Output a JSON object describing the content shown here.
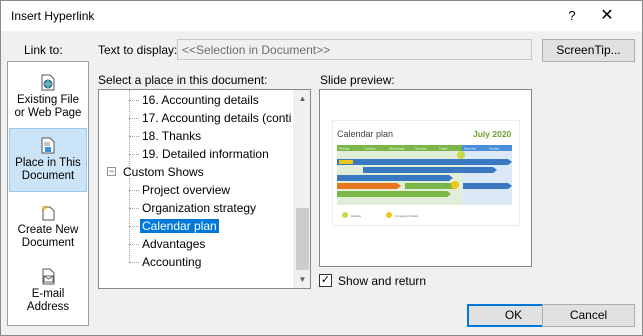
{
  "window": {
    "title": "Insert Hyperlink",
    "help_glyph": "?",
    "close_glyph": "✕"
  },
  "link_to": {
    "label": "Link to:",
    "items": [
      {
        "label_line1": "Existing File",
        "label_line2": "or Web Page",
        "icon": "globe-document-icon"
      },
      {
        "label_line1": "Place in This",
        "label_line2": "Document",
        "icon": "document-place-icon",
        "selected": true
      },
      {
        "label_line1": "Create New",
        "label_line2": "Document",
        "icon": "new-document-icon"
      },
      {
        "label_line1": "E-mail",
        "label_line2": "Address",
        "icon": "email-icon"
      }
    ]
  },
  "text_to_display": {
    "label": "Text to display:",
    "value": "<<Selection in Document>>"
  },
  "screentip_label": "ScreenTip...",
  "place": {
    "label": "Select a place in this document:",
    "items": [
      {
        "text": "16. Accounting details"
      },
      {
        "text": "17. Accounting details (conti"
      },
      {
        "text": "18. Thanks"
      },
      {
        "text": "19. Detailed information"
      },
      {
        "text": "Custom Shows",
        "expander": "−"
      },
      {
        "text": "Project overview"
      },
      {
        "text": "Organization strategy"
      },
      {
        "text": "Calendar plan",
        "selected": true
      },
      {
        "text": "Advantages"
      },
      {
        "text": "Accounting"
      }
    ]
  },
  "slide_preview": {
    "label": "Slide preview:",
    "slide_title": "Calendar plan",
    "slide_date": "July 2020",
    "days": [
      "Monday",
      "Tuesday",
      "Wednesday",
      "Thursday",
      "Friday",
      "Saturday",
      "Sunday"
    ],
    "legend_holiday": "Holiday",
    "legend_company": "Company holiday"
  },
  "show_and_return": {
    "label": "Show and return",
    "checked": true,
    "check_glyph": "✓"
  },
  "buttons": {
    "ok": "OK",
    "cancel": "Cancel"
  }
}
